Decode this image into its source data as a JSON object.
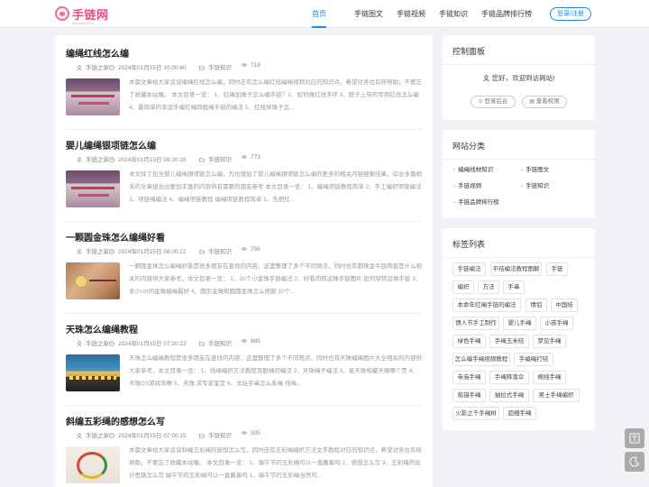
{
  "header": {
    "logo_text": "手链网",
    "logo_sub": "shoulian.com",
    "nav": [
      "首页",
      "手链图文",
      "手链视频",
      "手链知识",
      "手链品牌排行榜"
    ],
    "login_label": "登录/注册"
  },
  "articles": [
    {
      "title": "编绳红线怎么编",
      "author": "手链之家",
      "date": "2024年01月15日 10:00:40",
      "category": "手链知识",
      "views": "718",
      "excerpt": "本篇文章给大家谈谈编绳红线怎么编，同时还有怎么编红线编绳视频对应的知识点，希望对各位有所帮助，不要忘了收藏本站喔。 本文目录一览： 1、红绳加珠子怎么编手链？2、如何做红线手环 3、脖子上带的专用红线怎么编 4、最简单的幸运手编红绳四股绳手链的编法 5、红线穿珠子怎..."
    },
    {
      "title": "婴儿编绳银项链怎么编",
      "author": "手链之家",
      "date": "2024年01月15日 09:30:19",
      "category": "手链知识",
      "views": "773",
      "excerpt": "本文除了包含婴儿编绳银项链怎么编，为也增加了婴儿编绳银项链怎么编的更多的相关内容搜索结果。综合多篇相关的文章组合出更加丰富的内容供有需要的朋友参考 本文目录一览： 1、编绳项链教程简单 2、手工编织项链编法 3、项链绳编法 4、编绳项链教程 编绳项链教程简单 1、先把红..."
    },
    {
      "title": "一颗圆金珠怎么编绳好看",
      "author": "手链之家",
      "date": "2024年01月15日 08:00:22",
      "category": "手链知识",
      "views": "758",
      "excerpt": "一颗圆金珠怎么编绳好看是很多朋友在查找的内容，这里整理了多个不同观点，同时也有圆珠金手链简直是什么相关的内容供大家参考。本文目录一览： 1、10个小金珠手链编法 2、好看的转运珠手链图片,如何穿转运珠手链 3、多少cm的金珠编绳最好 4、圆形金珠和圆圆金珠怎么搭配 10个..."
    },
    {
      "title": "天珠怎么编绳教程",
      "author": "手链之家",
      "date": "2024年01月15日 07:30:22",
      "category": "手链知识",
      "views": "685",
      "excerpt": "天珠怎么编绳教程是很多朋友在查找的内容，这里整理了多个不同观点，同时也有天珠编绳图片大全相关的内容供大家参考。本文目录一览： 1、线绳编织方法教程双股绳的编法 2、天珠绳子编法 3、星天珠和藏天珠哪个贵 4、天珠DS游戏攻略 5、天珠,求专家鉴定 6、文玩手串怎么系绳 线绳..."
    },
    {
      "title": "斜编五彩绳的感想怎么写",
      "author": "手链之家",
      "date": "2024年01月15日 07:00:15",
      "category": "手链知识",
      "views": "505",
      "excerpt": "本篇文章给大家谈谈斜编五彩绳的感想怎么写，同时还有五彩绳编织方法文字教程对应的知识点，希望对各位有所帮助，不要忘了收藏本站喔。 本文目录一览： 1、端午节的五彩绳可以一直戴着吗 2、感想怎么写 3、五彩绳的设计思路怎么写 端午节的五彩绳可以一直戴着吗 1、端午节的五彩绳当然可..."
    }
  ],
  "control_panel": {
    "title": "控制面板",
    "greeting": "您好，欢迎到访网站!",
    "login_label": "登录后台",
    "perm_label": "查看权限"
  },
  "categories_panel": {
    "title": "网站分类",
    "items": [
      "编绳线材知识",
      "手链图文",
      "手链视频",
      "手链知识",
      "手链品牌排行榜"
    ]
  },
  "tags_panel": {
    "title": "标签列表",
    "tags": [
      "手链编法",
      "平结编法教程图解",
      "手链",
      "编织",
      "方法",
      "手串",
      "本命年红绳手链的编法",
      "情侣",
      "中国结",
      "情人节手工制作",
      "婴儿手绳",
      "小孩手绳",
      "绿色手绳",
      "手绳玉米结",
      "梦见手绳",
      "怎么编手绳视频教程",
      "手编绳打结",
      "寺庙手绳",
      "手绳降落伞",
      "棉线手绳",
      "船锚手绳",
      "抽拉式手绳",
      "男士手绳编织",
      "火影之千手绳树",
      "超细手绳"
    ]
  },
  "icons": {
    "author": "user-icon",
    "date": "clock-icon",
    "category": "folder-icon",
    "views": "eye-icon"
  },
  "colors": {
    "accent": "#1e88e5",
    "brand": "#ea4c89"
  }
}
